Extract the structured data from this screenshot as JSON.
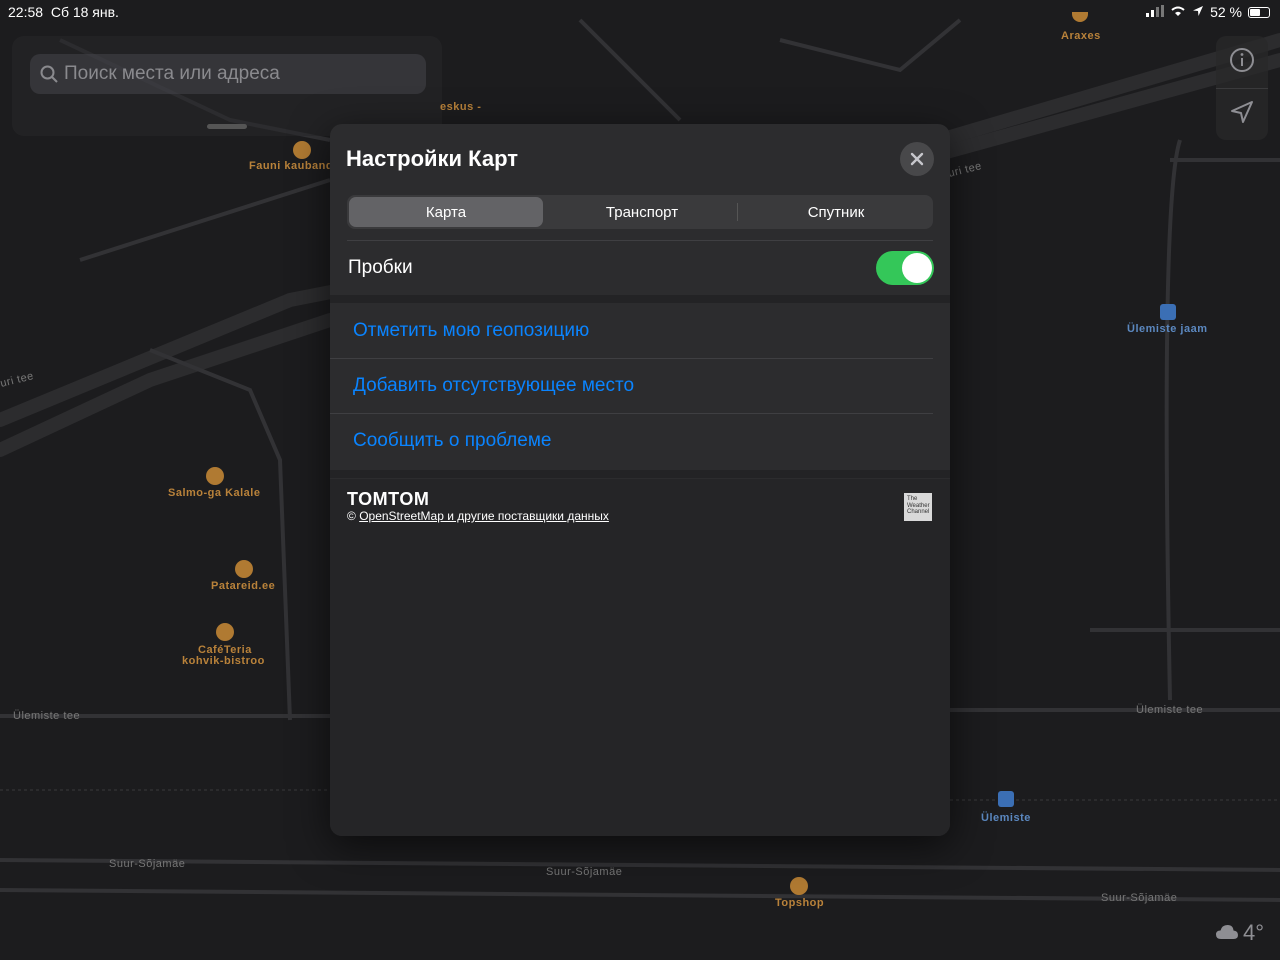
{
  "status_bar": {
    "time": "22:58",
    "date": "Сб 18 янв.",
    "battery": "52 %"
  },
  "search": {
    "placeholder": "Поиск места или адреса"
  },
  "map_labels": {
    "araxes": "Araxes",
    "eskus": "eskus -",
    "fauni": "Fauni kauband",
    "uri_tee_right": "uri tee",
    "uri_tee_left": "uri tee",
    "ulemiste_jaam": "Ülemiste jaam",
    "salmo": "Salmo-ga Kalale",
    "patareid": "Patareid.ee",
    "cafeteria_1": "CaféTeria",
    "cafeteria_2": "kohvik-bistroo",
    "ulemiste_tee_left": "Ülemiste tee",
    "ulemiste_tee_right": "Ülemiste tee",
    "ulemiste": "Ülemiste",
    "suur_1": "Suur-Sõjamäe",
    "suur_2": "Suur-Sõjamäe",
    "suur_3": "Suur-Sõjamäe",
    "topshop": "Topshop"
  },
  "weather": {
    "temperature": "4°"
  },
  "modal": {
    "title": "Настройки Карт",
    "tabs": [
      "Карта",
      "Транспорт",
      "Спутник"
    ],
    "active_tab": "Карта",
    "traffic_label": "Пробки",
    "traffic_on": true,
    "actions": [
      "Отметить мою геопозицию",
      "Добавить отсутствующее место",
      "Сообщить о проблеме"
    ],
    "tomtom": "TOMTOM",
    "osm_prefix": "© ",
    "osm_link": "OpenStreetMap и другие поставщики данных",
    "weather_channel": "The Weather Channel"
  },
  "colors": {
    "accent": "#0a84ff",
    "toggle_on": "#34c759",
    "poi_orange": "#b07a32",
    "transit_blue": "#3b6fb5"
  }
}
